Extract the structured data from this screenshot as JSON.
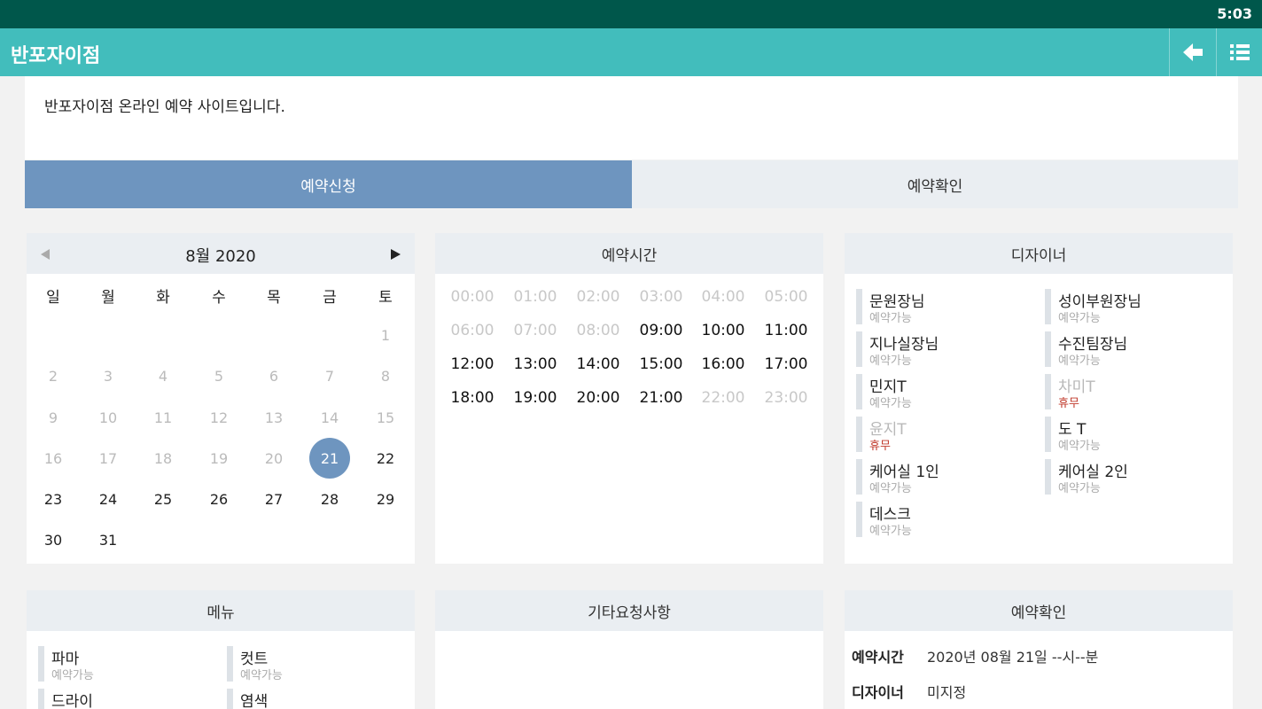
{
  "status_bar": {
    "time": "5:03"
  },
  "app_bar": {
    "title": "반포자이점"
  },
  "notice": {
    "text": "반포자이점 온라인 예약 사이트입니다."
  },
  "tabs": [
    {
      "label": "예약신청",
      "active": true
    },
    {
      "label": "예약확인",
      "active": false
    }
  ],
  "calendar": {
    "month_label": "8월 2020",
    "weekdays": [
      "일",
      "월",
      "화",
      "수",
      "목",
      "금",
      "토"
    ],
    "days": [
      {
        "d": "1",
        "s": "off"
      },
      {
        "d": "2",
        "s": "off"
      },
      {
        "d": "3",
        "s": "off"
      },
      {
        "d": "4",
        "s": "off"
      },
      {
        "d": "5",
        "s": "off"
      },
      {
        "d": "6",
        "s": "off"
      },
      {
        "d": "7",
        "s": "off"
      },
      {
        "d": "8",
        "s": "off"
      },
      {
        "d": "9",
        "s": "off"
      },
      {
        "d": "10",
        "s": "off"
      },
      {
        "d": "11",
        "s": "off"
      },
      {
        "d": "12",
        "s": "off"
      },
      {
        "d": "13",
        "s": "off"
      },
      {
        "d": "14",
        "s": "off"
      },
      {
        "d": "15",
        "s": "off"
      },
      {
        "d": "16",
        "s": "off"
      },
      {
        "d": "17",
        "s": "off"
      },
      {
        "d": "18",
        "s": "off"
      },
      {
        "d": "19",
        "s": "off"
      },
      {
        "d": "20",
        "s": "off"
      },
      {
        "d": "21",
        "s": "sel"
      },
      {
        "d": "22",
        "s": "on"
      },
      {
        "d": "23",
        "s": "on"
      },
      {
        "d": "24",
        "s": "on"
      },
      {
        "d": "25",
        "s": "on"
      },
      {
        "d": "26",
        "s": "on"
      },
      {
        "d": "27",
        "s": "on"
      },
      {
        "d": "28",
        "s": "on"
      },
      {
        "d": "29",
        "s": "on"
      },
      {
        "d": "30",
        "s": "on"
      },
      {
        "d": "31",
        "s": "on"
      }
    ],
    "first_weekday": 6,
    "selected_day": "21"
  },
  "time_panel": {
    "title": "예약시간",
    "slots": [
      {
        "t": "00:00",
        "a": false
      },
      {
        "t": "01:00",
        "a": false
      },
      {
        "t": "02:00",
        "a": false
      },
      {
        "t": "03:00",
        "a": false
      },
      {
        "t": "04:00",
        "a": false
      },
      {
        "t": "05:00",
        "a": false
      },
      {
        "t": "06:00",
        "a": false
      },
      {
        "t": "07:00",
        "a": false
      },
      {
        "t": "08:00",
        "a": false
      },
      {
        "t": "09:00",
        "a": true
      },
      {
        "t": "10:00",
        "a": true
      },
      {
        "t": "11:00",
        "a": true
      },
      {
        "t": "12:00",
        "a": true
      },
      {
        "t": "13:00",
        "a": true
      },
      {
        "t": "14:00",
        "a": true
      },
      {
        "t": "15:00",
        "a": true
      },
      {
        "t": "16:00",
        "a": true
      },
      {
        "t": "17:00",
        "a": true
      },
      {
        "t": "18:00",
        "a": true
      },
      {
        "t": "19:00",
        "a": true
      },
      {
        "t": "20:00",
        "a": true
      },
      {
        "t": "21:00",
        "a": true
      },
      {
        "t": "22:00",
        "a": false
      },
      {
        "t": "23:00",
        "a": false
      }
    ]
  },
  "designer_panel": {
    "title": "디자이너",
    "items": [
      {
        "name": "문원장님",
        "status": "예약가능",
        "closed": false
      },
      {
        "name": "성이부원장님",
        "status": "예약가능",
        "closed": false
      },
      {
        "name": "지나실장님",
        "status": "예약가능",
        "closed": false
      },
      {
        "name": "수진팀장님",
        "status": "예약가능",
        "closed": false
      },
      {
        "name": "민지T",
        "status": "예약가능",
        "closed": false
      },
      {
        "name": "차미T",
        "status": "휴무",
        "closed": true
      },
      {
        "name": "윤지T",
        "status": "휴무",
        "closed": true
      },
      {
        "name": "도 T",
        "status": "예약가능",
        "closed": false
      },
      {
        "name": "케어실 1인",
        "status": "예약가능",
        "closed": false
      },
      {
        "name": "케어실 2인",
        "status": "예약가능",
        "closed": false
      },
      {
        "name": "데스크",
        "status": "예약가능",
        "closed": false
      }
    ]
  },
  "menu_panel": {
    "title": "메뉴",
    "items": [
      {
        "name": "파마",
        "status": "예약가능"
      },
      {
        "name": "컷트",
        "status": "예약가능"
      },
      {
        "name": "드라이",
        "status": ""
      },
      {
        "name": "염색",
        "status": ""
      }
    ]
  },
  "extra_panel": {
    "title": "기타요청사항"
  },
  "confirm_panel": {
    "title": "예약확인",
    "rows": [
      {
        "label": "예약시간",
        "value": "2020년 08월 21일 --시--분"
      },
      {
        "label": "디자이너",
        "value": "미지정"
      }
    ]
  },
  "colors": {
    "status_bar": "#00574b",
    "app_bar": "#42bdbc",
    "active_tab": "#6e95bf",
    "closed": "#c0392b"
  }
}
